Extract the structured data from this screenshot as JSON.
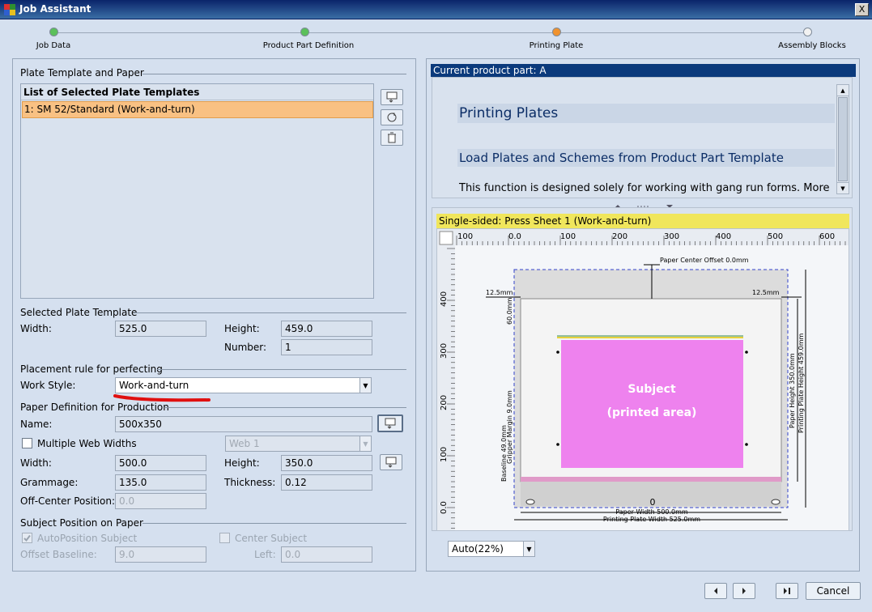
{
  "window": {
    "title": "Job Assistant",
    "close_glyph": "X"
  },
  "stepper": {
    "steps": [
      {
        "label": "Job Data",
        "state": "done",
        "color": "#5bc05b"
      },
      {
        "label": "Product Part Definition",
        "state": "done",
        "color": "#5bc05b"
      },
      {
        "label": "Printing Plate",
        "state": "current",
        "color": "#f0922e"
      },
      {
        "label": "Assembly Blocks",
        "state": "pending",
        "color": "#f2f2f2"
      }
    ]
  },
  "left": {
    "plate_section_title": "Plate Template and Paper",
    "list_header": "List of Selected Plate Templates",
    "list_items": [
      "1: SM 52/Standard (Work-and-turn)"
    ],
    "selected_title": "Selected Plate Template",
    "width_label": "Width:",
    "width_value": "525.0",
    "height_label": "Height:",
    "height_value": "459.0",
    "number_label": "Number:",
    "number_value": "1",
    "placement_title": "Placement rule for perfecting",
    "workstyle_label": "Work Style:",
    "workstyle_value": "Work-and-turn",
    "paper_title": "Paper Definition for Production",
    "name_label": "Name:",
    "name_value": "500x350",
    "multi_web_label": "Multiple Web Widths",
    "web_value": "Web 1",
    "paper_width_label": "Width:",
    "paper_width_value": "500.0",
    "paper_height_label": "Height:",
    "paper_height_value": "350.0",
    "grammage_label": "Grammage:",
    "grammage_value": "135.0",
    "thickness_label": "Thickness:",
    "thickness_value": "0.12",
    "offcenter_label": "Off-Center Position:",
    "offcenter_value": "0.0",
    "subject_title": "Subject Position on Paper",
    "autopos_label": "AutoPosition Subject",
    "center_label": "Center Subject",
    "baseline_label": "Offset Baseline:",
    "baseline_value": "9.0",
    "left_label": "Left:",
    "left_value": "0.0"
  },
  "right": {
    "product_part": "Current product part: A",
    "help_title": "Printing Plates",
    "help_subtitle": "Load Plates and Schemes from Product Part Template",
    "help_text": "This function is designed solely for working with gang run forms. More",
    "sheet_label": "Single-sided:  Press Sheet 1 (Work-and-turn)",
    "zoom_value": "Auto(22%)",
    "ruler_top": [
      "100",
      "0.0",
      "100",
      "200",
      "300",
      "400",
      "500",
      "600"
    ],
    "ruler_left": [
      "400",
      "300",
      "200",
      "100",
      "0.0"
    ],
    "preview": {
      "paper_center_offset": "Paper Center Offset 0.0mm",
      "margin_left": "12.5mm",
      "margin_right": "12.5mm",
      "top_margin": "60.0mm",
      "subject_line1": "Subject",
      "subject_line2": "(printed area)",
      "paper_width": "Paper Width 500.0mm",
      "plate_width": "Printing Plate Width 525.0mm",
      "paper_height": "Paper Height 350.0mm",
      "plate_height": "Printing Plate Height 459.0mm",
      "gripper_margin": "Gripper Margin 9.0mm",
      "baseline": "Baseline 49.0mm",
      "zero_mark": "0",
      "subject_color": "#ee82ee"
    }
  },
  "footer": {
    "cancel_label": "Cancel"
  }
}
